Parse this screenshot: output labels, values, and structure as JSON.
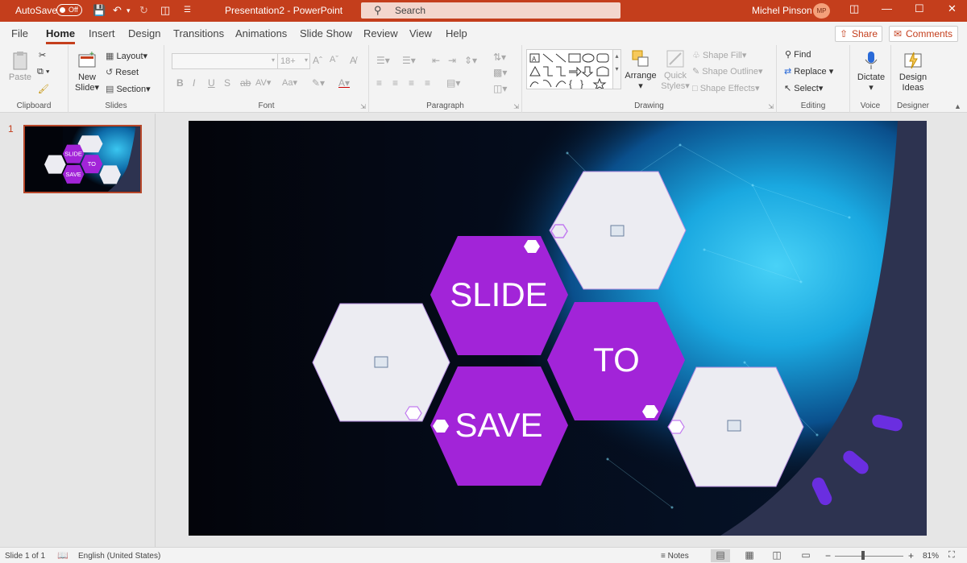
{
  "titlebar": {
    "autosave_label": "AutoSave",
    "autosave_state": "Off",
    "doc_title": "Presentation2  -  PowerPoint",
    "search_placeholder": "Search",
    "user_name": "Michel Pinson",
    "user_initials": "MP"
  },
  "tabs": [
    "File",
    "Home",
    "Insert",
    "Design",
    "Transitions",
    "Animations",
    "Slide Show",
    "Review",
    "View",
    "Help"
  ],
  "active_tab": "Home",
  "share_label": "Share",
  "comments_label": "Comments",
  "ribbon": {
    "clipboard": {
      "paste": "Paste",
      "label": "Clipboard"
    },
    "slides": {
      "new_slide_1": "New",
      "new_slide_2": "Slide",
      "layout": "Layout",
      "reset": "Reset",
      "section": "Section",
      "label": "Slides"
    },
    "font": {
      "size": "18+",
      "label": "Font"
    },
    "paragraph": {
      "label": "Paragraph"
    },
    "drawing": {
      "arrange": "Arrange",
      "quick_styles_1": "Quick",
      "quick_styles_2": "Styles",
      "shape_fill": "Shape Fill",
      "shape_outline": "Shape Outline",
      "shape_effects": "Shape Effects",
      "label": "Drawing"
    },
    "editing": {
      "find": "Find",
      "replace": "Replace",
      "select": "Select",
      "label": "Editing"
    },
    "voice": {
      "dictate": "Dictate",
      "label": "Voice"
    },
    "designer": {
      "design_ideas_1": "Design",
      "design_ideas_2": "Ideas",
      "label": "Designer"
    }
  },
  "thumbnail": {
    "number": "1",
    "words": [
      "SLIDE",
      "TO",
      "SAVE"
    ]
  },
  "slide": {
    "words": [
      "SLIDE",
      "TO",
      "SAVE"
    ]
  },
  "statusbar": {
    "slide_info": "Slide 1 of 1",
    "language": "English (United States)",
    "notes": "Notes",
    "zoom": "81%",
    "zoom_minus": "−",
    "zoom_plus": "+"
  },
  "colors": {
    "accent": "#c43e1c",
    "hex_purple": "#a224d8",
    "hex_light": "#ececf2",
    "glow": "#1aa8e0"
  }
}
